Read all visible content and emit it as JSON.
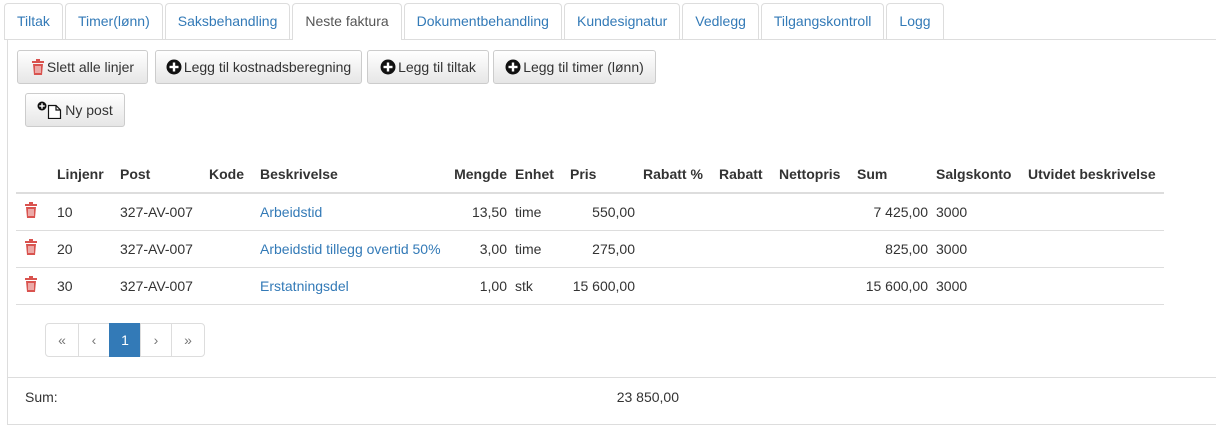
{
  "tabs": [
    {
      "label": "Tiltak"
    },
    {
      "label": "Timer(lønn)"
    },
    {
      "label": "Saksbehandling"
    },
    {
      "label": "Neste faktura",
      "active": true
    },
    {
      "label": "Dokumentbehandling"
    },
    {
      "label": "Kundesignatur"
    },
    {
      "label": "Vedlegg"
    },
    {
      "label": "Tilgangskontroll"
    },
    {
      "label": "Logg"
    }
  ],
  "toolbar": {
    "delete_all_label": "Slett alle linjer",
    "add_cost_label": "Legg til kostnadsberegning",
    "add_measure_label": "Legg til tiltak",
    "add_hours_label": "Legg til timer (lønn)",
    "new_post_label": "Ny post"
  },
  "table": {
    "headers": [
      "Linjenr",
      "Post",
      "Kode",
      "Beskrivelse",
      "Mengde",
      "Enhet",
      "Pris",
      "Rabatt %",
      "Rabatt",
      "Nettopris",
      "Sum",
      "Salgskonto",
      "Utvidet beskrivelse"
    ],
    "rows": [
      {
        "linjenr": "10",
        "post": "327-AV-007",
        "kode": "",
        "beskrivelse": "Arbeidstid",
        "mengde": "13,50",
        "enhet": "time",
        "pris": "550,00",
        "rabatt_pct": "",
        "rabatt": "",
        "nettopris": "",
        "sum": "7 425,00",
        "salgskonto": "3000",
        "utvidet": ""
      },
      {
        "linjenr": "20",
        "post": "327-AV-007",
        "kode": "",
        "beskrivelse": "Arbeidstid tillegg overtid 50%",
        "mengde": "3,00",
        "enhet": "time",
        "pris": "275,00",
        "rabatt_pct": "",
        "rabatt": "",
        "nettopris": "",
        "sum": "825,00",
        "salgskonto": "3000",
        "utvidet": ""
      },
      {
        "linjenr": "30",
        "post": "327-AV-007",
        "kode": "",
        "beskrivelse": "Erstatningsdel",
        "mengde": "1,00",
        "enhet": "stk",
        "pris": "15 600,00",
        "rabatt_pct": "",
        "rabatt": "",
        "nettopris": "",
        "sum": "15 600,00",
        "salgskonto": "3000",
        "utvidet": ""
      }
    ]
  },
  "pagination": {
    "first": "«",
    "prev": "‹",
    "current": "1",
    "next": "›",
    "last": "»"
  },
  "summary": {
    "label": "Sum:",
    "value": "23 850,00"
  },
  "colors": {
    "link": "#337ab7",
    "danger": "#d9534f",
    "border": "#dddddd"
  },
  "icons": {
    "delete": "trash-icon",
    "add": "plus-circle-icon",
    "new_document": "new-document-icon"
  }
}
